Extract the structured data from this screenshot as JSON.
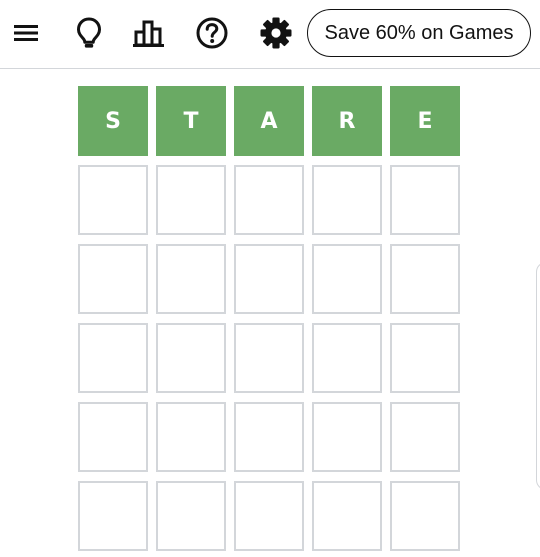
{
  "toolbar": {
    "icons": [
      "menu-icon",
      "lightbulb-icon",
      "stats-icon",
      "help-icon",
      "gear-icon"
    ],
    "promo_label": "Save 60% on Games"
  },
  "board": {
    "rows": [
      [
        {
          "letter": "S",
          "state": "correct"
        },
        {
          "letter": "T",
          "state": "correct"
        },
        {
          "letter": "A",
          "state": "correct"
        },
        {
          "letter": "R",
          "state": "correct"
        },
        {
          "letter": "E",
          "state": "correct"
        }
      ],
      [
        {
          "letter": "",
          "state": "empty"
        },
        {
          "letter": "",
          "state": "empty"
        },
        {
          "letter": "",
          "state": "empty"
        },
        {
          "letter": "",
          "state": "empty"
        },
        {
          "letter": "",
          "state": "empty"
        }
      ],
      [
        {
          "letter": "",
          "state": "empty"
        },
        {
          "letter": "",
          "state": "empty"
        },
        {
          "letter": "",
          "state": "empty"
        },
        {
          "letter": "",
          "state": "empty"
        },
        {
          "letter": "",
          "state": "empty"
        }
      ],
      [
        {
          "letter": "",
          "state": "empty"
        },
        {
          "letter": "",
          "state": "empty"
        },
        {
          "letter": "",
          "state": "empty"
        },
        {
          "letter": "",
          "state": "empty"
        },
        {
          "letter": "",
          "state": "empty"
        }
      ],
      [
        {
          "letter": "",
          "state": "empty"
        },
        {
          "letter": "",
          "state": "empty"
        },
        {
          "letter": "",
          "state": "empty"
        },
        {
          "letter": "",
          "state": "empty"
        },
        {
          "letter": "",
          "state": "empty"
        }
      ],
      [
        {
          "letter": "",
          "state": "empty"
        },
        {
          "letter": "",
          "state": "empty"
        },
        {
          "letter": "",
          "state": "empty"
        },
        {
          "letter": "",
          "state": "empty"
        },
        {
          "letter": "",
          "state": "empty"
        }
      ]
    ]
  },
  "colors": {
    "correct": "#6aaa64",
    "tile_border": "#d3d6da",
    "icon": "#121212"
  }
}
